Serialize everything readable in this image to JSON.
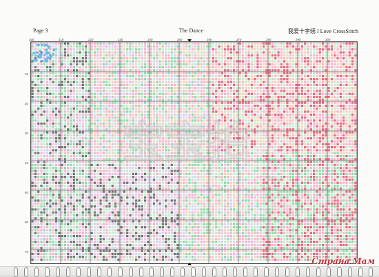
{
  "header": {
    "page_label": "Page 3",
    "title": "The Dance",
    "brand": "我爱十字绣 I Love CrossStitch"
  },
  "chart": {
    "col_numbers": [
      "200",
      "210",
      "220",
      "230",
      "240",
      "250",
      "260",
      "270",
      "280",
      "290",
      "300"
    ],
    "row_numbers": [
      "",
      "10",
      "20",
      "30",
      "40",
      "50",
      "60",
      "70"
    ],
    "colors": {
      "pink": "#f4a8c4",
      "mint": "#bfe8c8",
      "green": "#7fd49a",
      "blue": "#6fb6e8",
      "red": "#e05068",
      "lavender": "#d8c8ec",
      "peach": "#f6c9b0",
      "dark": "#3a3a3a",
      "grid": "#6a6a6a"
    }
  },
  "watermark": "Страна Мам",
  "stamp_text": "宝宝拍"
}
